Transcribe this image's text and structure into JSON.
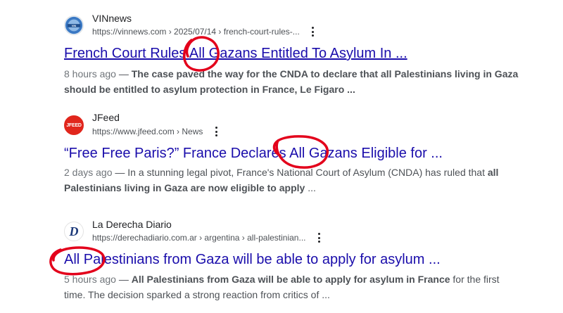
{
  "results": [
    {
      "site": "VINnews",
      "url": "https://vinnews.com › 2025/07/14 › french-court-rules-...",
      "title": "French Court Rules All Gazans Entitled To Asylum In ...",
      "date": "8 hours ago",
      "dash": " — ",
      "snippet_a": "The case paved the way for the CNDA to declare that ",
      "snippet_b": "all Palestinians living in Gaza should be entitled to asylum protection in France",
      "snippet_c": ", Le Figaro ..."
    },
    {
      "site": "JFeed",
      "url": "https://www.jfeed.com › News",
      "title": "“Free Free Paris?” France Declares All Gazans Eligible for ...",
      "date": "2 days ago",
      "dash": " — ",
      "snippet_a": "In a stunning legal pivot, France's National Court of Asylum (CNDA) has ruled that ",
      "snippet_b": "all Palestinians living in Gaza are now eligible to apply",
      "snippet_c": " ..."
    },
    {
      "site": "La Derecha Diario",
      "url": "https://derechadiario.com.ar › argentina › all-palestinian...",
      "title": "All Palestinians from Gaza will be able to apply for asylum ...",
      "date": "5 hours ago",
      "dash": " — ",
      "snippet_a": "All Palestinians from Gaza will be able to apply for asylum in France",
      "snippet_b": " for the first time. The decision sparked a strong reaction from critics of ..."
    }
  ],
  "favicons": {
    "vinnews_text": "VIN",
    "jfeed_text": "JFEED",
    "derecha_text": "D"
  },
  "colors": {
    "link": "#1a0dab",
    "annotation": "#e3001b"
  }
}
